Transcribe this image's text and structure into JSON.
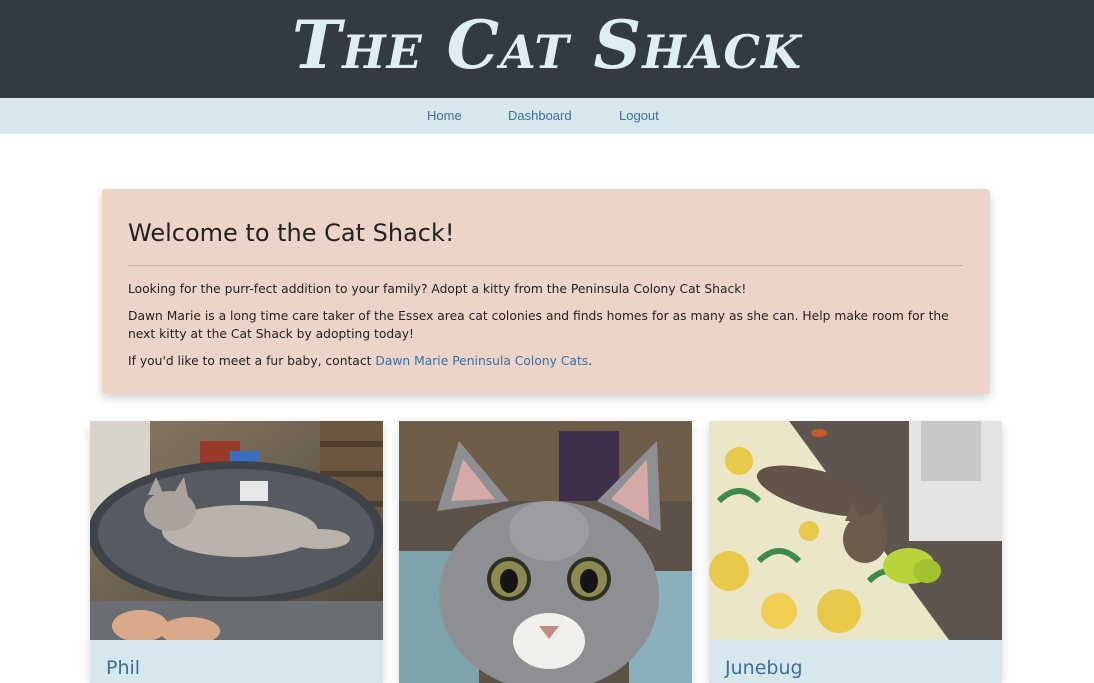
{
  "header": {
    "logo_text": "The Cat Shack"
  },
  "nav": {
    "items": [
      {
        "label": "Home"
      },
      {
        "label": "Dashboard"
      },
      {
        "label": "Logout"
      }
    ]
  },
  "welcome": {
    "title": "Welcome to the Cat Shack!",
    "paragraph1": "Looking for the purr-fect addition to your family? Adopt a kitty from the Peninsula Colony Cat Shack!",
    "paragraph2": "Dawn Marie is a long time care taker of the Essex area cat colonies and finds homes for as many as she can. Help make room for the next kitty at the Cat Shack by adopting today!",
    "paragraph3_prefix": "If you'd like to meet a fur baby, contact ",
    "contact_link": "Dawn Marie Peninsula Colony Cats",
    "paragraph3_suffix": "."
  },
  "cats": [
    {
      "name": "Phil"
    },
    {
      "name": ""
    },
    {
      "name": "Junebug"
    }
  ],
  "colors": {
    "header_bg": "#343a45",
    "nav_bg": "#d6e8ee",
    "jumbotron_bg": "#ecd5c8",
    "link": "#3f6f95"
  }
}
